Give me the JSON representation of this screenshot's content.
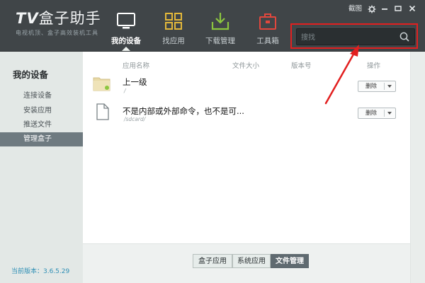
{
  "app": {
    "logo_title_prefix": "TV",
    "logo_title_rest": "盒子助手",
    "logo_subtitle": "电视机顶、盒子高效装机工具"
  },
  "nav": [
    {
      "label": "我的设备",
      "icon": "monitor-icon",
      "active": true
    },
    {
      "label": "找应用",
      "icon": "app-grid-icon",
      "active": false
    },
    {
      "label": "下载管理",
      "icon": "download-icon",
      "active": false
    },
    {
      "label": "工具箱",
      "icon": "toolbox-icon",
      "active": false
    }
  ],
  "window_controls": {
    "feedback_label": "截图",
    "settings_icon": "gear-icon",
    "minimize_icon": "minimize-icon",
    "close_icon": "close-icon"
  },
  "search": {
    "placeholder": "搜找",
    "icon": "search-icon"
  },
  "sidebar": {
    "title": "我的设备",
    "items": [
      {
        "label": "连接设备",
        "active": false
      },
      {
        "label": "安装应用",
        "active": false
      },
      {
        "label": "推送文件",
        "active": false
      },
      {
        "label": "管理盒子",
        "active": true
      }
    ],
    "version_label": "当前版本：3.6.5.29"
  },
  "table": {
    "headers": {
      "name": "应用名称",
      "size": "文件大小",
      "version": "版本号",
      "action": "操作"
    },
    "rows": [
      {
        "name": "上一级",
        "sub": "/",
        "icon": "folder-icon",
        "action": "删除"
      },
      {
        "name": "不是内部或外部命令，也不是可...",
        "sub": "/sdcard/",
        "icon": "file-icon",
        "action": "删除"
      }
    ]
  },
  "bottom_tabs": [
    {
      "label": "盒子应用",
      "active": false
    },
    {
      "label": "系统应用",
      "active": false
    },
    {
      "label": "文件管理",
      "active": true
    }
  ],
  "colors": {
    "topbar": "#404548",
    "active_tab": "#5f6a70",
    "annotation_red": "#e21f1f",
    "nav_icon_yellow": "#e3b83a",
    "nav_icon_green": "#8cc63f",
    "nav_icon_red": "#e2473d",
    "version_blue": "#2f8fb5"
  }
}
